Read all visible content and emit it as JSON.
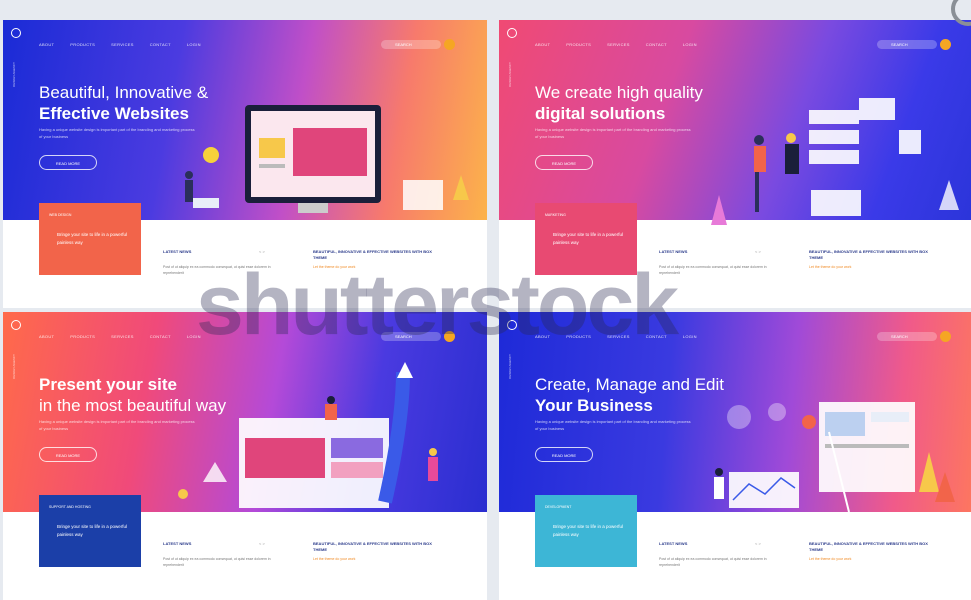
{
  "cards": [
    {
      "nav": [
        "ABOUT",
        "PRODUCTS",
        "SERVICES",
        "CONTACT",
        "LOGIN"
      ],
      "search": "SEARCH",
      "headline_light": "Beautiful, Innovative &",
      "headline_bold": "Effective Websites",
      "description": "Having a unique website design is important part of the branding and marketing process of your business",
      "button": "READ MORE",
      "box_kicker": "WEB DESIGN",
      "box_text": "Bringe your site to life in a powerful painless way",
      "news_title": "LATEST NEWS",
      "news_text": "Post of ut aliquip ex ea commodo consequat, ut quisi esse dolorem in reprehenderit",
      "article_title": "BEAUTIFUL, INNOVATIVE & EFFECTIVE WEBSITES WITH BOX THEME",
      "article_link": "Let the theme do your work"
    },
    {
      "nav": [
        "ABOUT",
        "PRODUCTS",
        "SERVICES",
        "CONTACT",
        "LOGIN"
      ],
      "search": "SEARCH",
      "headline_light": "We create high quality",
      "headline_bold": "digital solutions",
      "description": "Having a unique website design is important part of the branding and marketing process of your business",
      "button": "READ MORE",
      "box_kicker": "MARKETING",
      "box_text": "Bringe your site to life in a powerful painless way",
      "news_title": "LATEST NEWS",
      "news_text": "Post of ut aliquip ex ea commodo consequat, ut quisi esse dolorem in reprehenderit",
      "article_title": "BEAUTIFUL, INNOVATIVE & EFFECTIVE WEBSITES WITH BOX THEME",
      "article_link": "Let the theme do your work"
    },
    {
      "nav": [
        "ABOUT",
        "PRODUCTS",
        "SERVICES",
        "CONTACT",
        "LOGIN"
      ],
      "search": "SEARCH",
      "headline_bold": "Present your site",
      "headline_light": "in the most beautiful way",
      "description": "Having a unique website design is important part of the branding and marketing process of your business",
      "button": "READ MORE",
      "box_kicker": "SUPPORT AND HOSTING",
      "box_text": "Bringe your site to life in a powerful painless way",
      "news_title": "LATEST NEWS",
      "news_text": "Post of ut aliquip ex ea commodo consequat, ut quisi esse dolorem in reprehenderit",
      "article_title": "BEAUTIFUL, INNOVATIVE & EFFECTIVE WEBSITES WITH BOX THEME",
      "article_link": "Let the theme do your work"
    },
    {
      "nav": [
        "ABOUT",
        "PRODUCTS",
        "SERVICES",
        "CONTACT",
        "LOGIN"
      ],
      "search": "SEARCH",
      "headline_light": "Create, Manage and Edit",
      "headline_bold": "Your Business",
      "description": "Having a unique website design is important part of the branding and marketing process of your business",
      "button": "READ MORE",
      "box_kicker": "DEVELOPMENT",
      "box_text": "Bringe your site to life in a powerful painless way",
      "news_title": "LATEST NEWS",
      "news_text": "Post of ut aliquip ex ea commodo consequat, ut quisi esse dolorem in reprehenderit",
      "article_title": "BEAUTIFUL, INNOVATIVE & EFFECTIVE WEBSITES WITH BOX THEME",
      "article_link": "Let the theme do your work"
    }
  ],
  "watermark": "shutterstock",
  "colors": {
    "card1_box": "#f2644a",
    "card2_box": "#e84a72",
    "card3_box": "#1b3fa8",
    "card4_box": "#3db6d6",
    "accent": "#f08a24"
  }
}
